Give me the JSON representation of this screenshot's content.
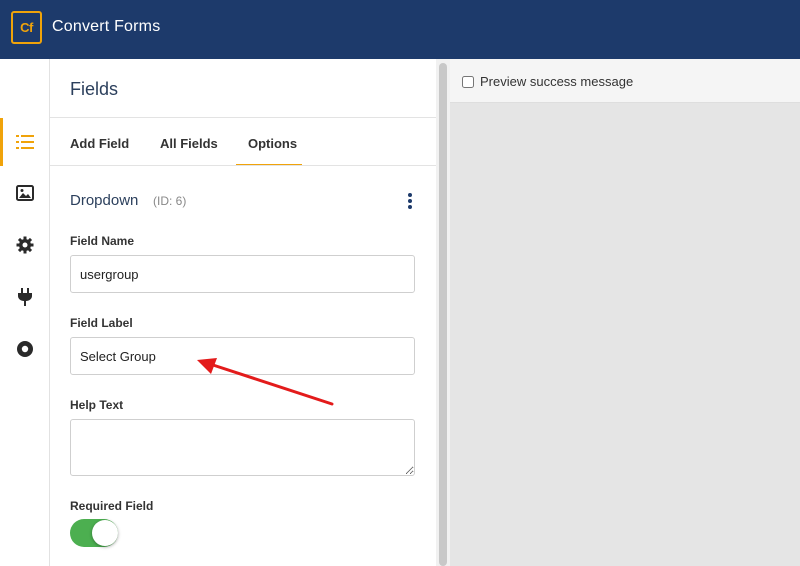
{
  "app": {
    "logo_text": "Cf",
    "title": "Convert Forms",
    "accent_color": "#f0a30a",
    "topbar_color": "#1d3a6b"
  },
  "sidebar_icons": [
    "list-icon",
    "image-icon",
    "gear-icon",
    "plug-icon",
    "record-icon"
  ],
  "panel": {
    "title": "Fields",
    "tabs": [
      {
        "label": "Add Field",
        "active": false
      },
      {
        "label": "All Fields",
        "active": false
      },
      {
        "label": "Options",
        "active": true
      }
    ],
    "field": {
      "type": "Dropdown",
      "id_label": "(ID: 6)"
    },
    "field_name": {
      "label": "Field Name",
      "value": "usergroup"
    },
    "field_label": {
      "label": "Field Label",
      "value": "Select Group"
    },
    "help_text": {
      "label": "Help Text",
      "value": ""
    },
    "required": {
      "label": "Required Field",
      "enabled": true,
      "on_color": "#4caf50"
    }
  },
  "preview": {
    "checkbox_label": "Preview success message",
    "checked": false
  },
  "annotation": {
    "arrow_color": "#e31b1b"
  }
}
